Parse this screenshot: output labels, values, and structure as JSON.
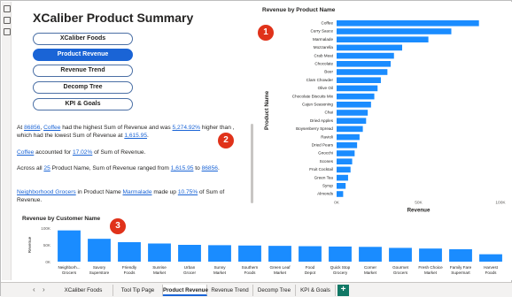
{
  "colors": {
    "bar": "#1a8cff",
    "accent": "#1a64d6",
    "badge": "#e0321a",
    "tab_add": "#117865"
  },
  "page_title": "XCaliber Product Summary",
  "nav_buttons": [
    {
      "label": "XCaliber Foods",
      "active": false
    },
    {
      "label": "Product Revenue",
      "active": true
    },
    {
      "label": "Revenue Trend",
      "active": false
    },
    {
      "label": "Decomp Tree",
      "active": false
    },
    {
      "label": "KPI & Goals",
      "active": false
    }
  ],
  "narrative": {
    "p1": {
      "a": "At ",
      "v1": "86856",
      "b": ", ",
      "v2": "Coffee",
      "c": " had the highest Sum of Revenue and was ",
      "v3": "5,274.92%",
      "d": " higher than , which had the lowest Sum of Revenue at ",
      "v4": "1,615.95",
      "e": "."
    },
    "p2": {
      "v1": "Coffee",
      "a": " accounted for ",
      "v2": "17.02%",
      "b": " of Sum of Revenue."
    },
    "p3": {
      "a": "Across all ",
      "v1": "25",
      "b": " Product Name, Sum of Revenue ranged from ",
      "v2": "1,615.95",
      "c": " to ",
      "v3": "86856",
      "d": "."
    },
    "p4": {
      "v1": "Neighborhood Grocers",
      "a": " in Product Name ",
      "v2": "Marmalade",
      "b": " made up ",
      "v3": "10.75%",
      "c": " of Sum of Revenue."
    }
  },
  "badges": [
    "1",
    "2",
    "3"
  ],
  "chart_data": [
    {
      "type": "bar",
      "orientation": "horizontal",
      "title": "Revenue by Product Name",
      "xlabel": "Revenue",
      "ylabel": "Product Name",
      "xlim": [
        0,
        100000
      ],
      "x_ticks": [
        "0K",
        "50K",
        "100K"
      ],
      "categories": [
        "Coffee",
        "Curry Sauce",
        "Marmalade",
        "Mozzarella",
        "Crab Meat",
        "Chocolate",
        "Beer",
        "Clam Chowder",
        "Olive Oil",
        "Chocolate Biscuits Mix",
        "Cajun Seasoning",
        "Chai",
        "Dried Apples",
        "Boysenberry Spread",
        "Ravioli",
        "Dried Pears",
        "Gnocchi",
        "Scones",
        "Fruit Cocktail",
        "Green Tea",
        "Syrup",
        "Almonds"
      ],
      "values": [
        86856,
        70000,
        56000,
        40000,
        35000,
        33000,
        31000,
        27000,
        25000,
        23000,
        21000,
        19000,
        18000,
        16000,
        14000,
        12500,
        11000,
        9500,
        8500,
        7000,
        5500,
        4000
      ],
      "grid": false
    },
    {
      "type": "bar",
      "orientation": "vertical",
      "title": "Revenue by Customer Name",
      "ylabel": "Revenue",
      "ylim": [
        0,
        100000
      ],
      "y_ticks": [
        "100K",
        "50K",
        "0K"
      ],
      "categories": [
        "Neighborh... Grocers",
        "Savory Superstore",
        "Friendly Foods",
        "Sunrise Market",
        "Urban Grocer",
        "Sunny Market",
        "Southern Foods",
        "Green Leaf Market",
        "Food Depot",
        "Quick Stop Grocery",
        "Corner Market",
        "Gourmet Grocers",
        "Fresh Choice Market",
        "Family Fare Supermart",
        "Harvest Foods"
      ],
      "values": [
        93000,
        68000,
        58000,
        54000,
        50000,
        49000,
        48000,
        47000,
        46000,
        45000,
        44000,
        41000,
        39000,
        37000,
        22000
      ],
      "grid": false
    }
  ],
  "tabs": [
    {
      "label": "XCaliber Foods",
      "active": false
    },
    {
      "label": "Tool Tip Page",
      "active": false
    },
    {
      "label": "Product Revenue",
      "active": true
    },
    {
      "label": "Revenue Trend",
      "active": false
    },
    {
      "label": "Decomp Tree",
      "active": false
    },
    {
      "label": "KPI & Goals",
      "active": false
    }
  ],
  "add_tab_label": "+",
  "tab_nav_icons": {
    "prev": "‹",
    "next": "›"
  }
}
